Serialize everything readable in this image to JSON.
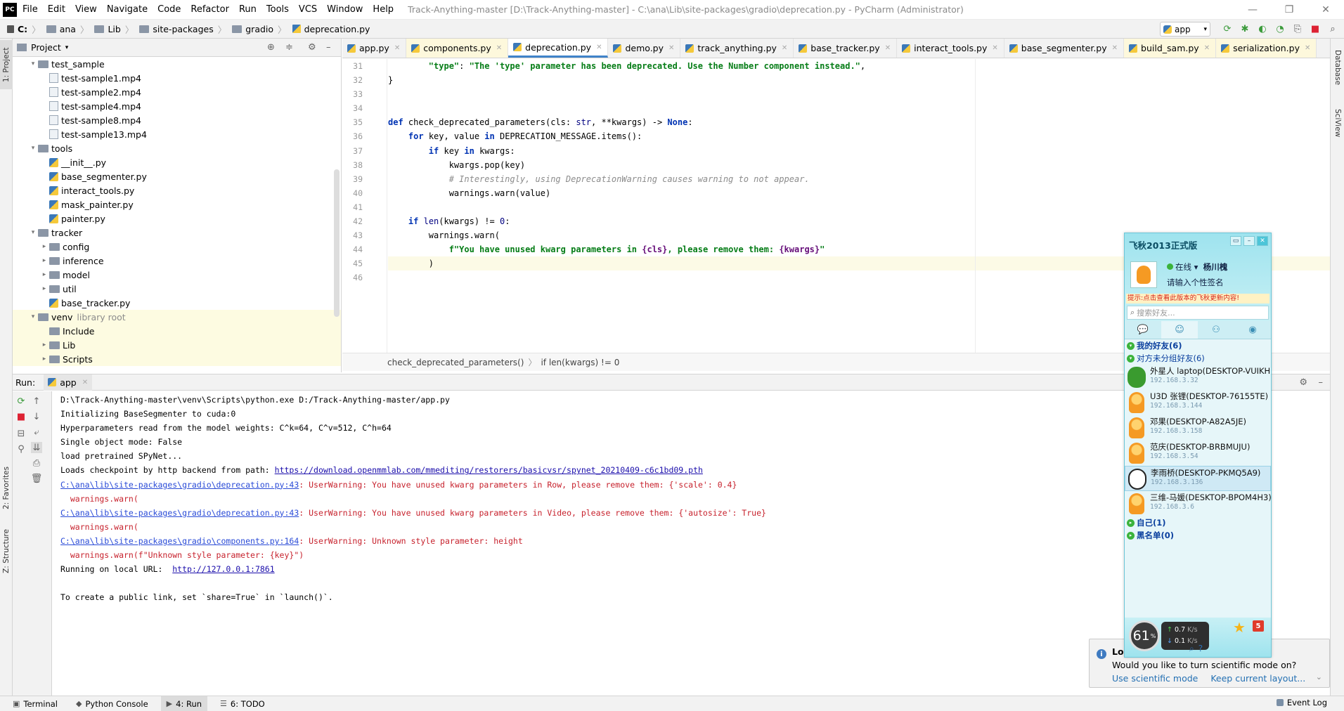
{
  "window": {
    "app_logo": "PC",
    "title": "Track-Anything-master [D:\\Track-Anything-master] - C:\\ana\\Lib\\site-packages\\gradio\\deprecation.py - PyCharm (Administrator)",
    "menu": [
      "File",
      "Edit",
      "View",
      "Navigate",
      "Code",
      "Refactor",
      "Run",
      "Tools",
      "VCS",
      "Window",
      "Help"
    ],
    "controls": [
      "—",
      "❐",
      "✕"
    ]
  },
  "breadcrumb": [
    "C:",
    "ana",
    "Lib",
    "site-packages",
    "gradio",
    "deprecation.py"
  ],
  "run_config": "app",
  "left_strip": {
    "project": "1: Project",
    "favorites": "2: Favorites",
    "structure": "Z: Structure"
  },
  "right_strip": {
    "database": "Database",
    "sciview": "SciView"
  },
  "project": {
    "title": "Project",
    "tree": [
      {
        "depth": 1,
        "arrow": "▾",
        "type": "folder",
        "label": "test_sample"
      },
      {
        "depth": 2,
        "arrow": "",
        "type": "file",
        "label": "test-sample1.mp4"
      },
      {
        "depth": 2,
        "arrow": "",
        "type": "file",
        "label": "test-sample2.mp4"
      },
      {
        "depth": 2,
        "arrow": "",
        "type": "file",
        "label": "test-sample4.mp4"
      },
      {
        "depth": 2,
        "arrow": "",
        "type": "file",
        "label": "test-sample8.mp4"
      },
      {
        "depth": 2,
        "arrow": "",
        "type": "file",
        "label": "test-sample13.mp4"
      },
      {
        "depth": 1,
        "arrow": "▾",
        "type": "folder",
        "label": "tools"
      },
      {
        "depth": 2,
        "arrow": "",
        "type": "py",
        "label": "__init__.py"
      },
      {
        "depth": 2,
        "arrow": "",
        "type": "py",
        "label": "base_segmenter.py"
      },
      {
        "depth": 2,
        "arrow": "",
        "type": "py",
        "label": "interact_tools.py"
      },
      {
        "depth": 2,
        "arrow": "",
        "type": "py",
        "label": "mask_painter.py"
      },
      {
        "depth": 2,
        "arrow": "",
        "type": "py",
        "label": "painter.py"
      },
      {
        "depth": 1,
        "arrow": "▾",
        "type": "folder",
        "label": "tracker"
      },
      {
        "depth": 2,
        "arrow": "▸",
        "type": "folder",
        "label": "config"
      },
      {
        "depth": 2,
        "arrow": "▸",
        "type": "folder",
        "label": "inference"
      },
      {
        "depth": 2,
        "arrow": "▸",
        "type": "folder",
        "label": "model"
      },
      {
        "depth": 2,
        "arrow": "▸",
        "type": "folder",
        "label": "util"
      },
      {
        "depth": 2,
        "arrow": "",
        "type": "py",
        "label": "base_tracker.py"
      },
      {
        "depth": 1,
        "arrow": "▾",
        "type": "folder",
        "label": "venv",
        "note": "library root",
        "highlight": true
      },
      {
        "depth": 2,
        "arrow": "",
        "type": "folder",
        "label": "Include",
        "highlight": true
      },
      {
        "depth": 2,
        "arrow": "▸",
        "type": "folder",
        "label": "Lib",
        "highlight": true
      },
      {
        "depth": 2,
        "arrow": "▸",
        "type": "folder",
        "label": "Scripts",
        "highlight": true
      }
    ]
  },
  "editor": {
    "tabs": [
      {
        "label": "app.py",
        "state": ""
      },
      {
        "label": "components.py",
        "state": "modified"
      },
      {
        "label": "deprecation.py",
        "state": "active"
      },
      {
        "label": "demo.py",
        "state": ""
      },
      {
        "label": "track_anything.py",
        "state": ""
      },
      {
        "label": "base_tracker.py",
        "state": ""
      },
      {
        "label": "interact_tools.py",
        "state": ""
      },
      {
        "label": "base_segmenter.py",
        "state": ""
      },
      {
        "label": "build_sam.py",
        "state": "modified"
      },
      {
        "label": "serialization.py",
        "state": "modified"
      }
    ],
    "line_numbers": [
      "31",
      "32",
      "33",
      "34",
      "35",
      "36",
      "37",
      "38",
      "39",
      "40",
      "41",
      "42",
      "43",
      "44",
      "45",
      "46"
    ],
    "current_line_index": 14,
    "breadcrumb": [
      "check_deprecated_parameters()",
      "if len(kwargs) != 0"
    ],
    "code": [
      [
        {
          "t": "        ",
          "c": ""
        },
        {
          "t": "\"type\"",
          "c": "str"
        },
        {
          "t": ": ",
          "c": ""
        },
        {
          "t": "\"The 'type' parameter has been deprecated. Use the Number component instead.\"",
          "c": "str"
        },
        {
          "t": ",",
          "c": ""
        }
      ],
      [
        {
          "t": "}",
          "c": ""
        }
      ],
      [],
      [],
      [
        {
          "t": "def ",
          "c": "kw"
        },
        {
          "t": "check_deprecated_parameters",
          "c": "fn"
        },
        {
          "t": "(cls: ",
          "c": ""
        },
        {
          "t": "str",
          "c": "bi"
        },
        {
          "t": ", **kwargs) -> ",
          "c": ""
        },
        {
          "t": "None",
          "c": "kw"
        },
        {
          "t": ":",
          "c": ""
        }
      ],
      [
        {
          "t": "    ",
          "c": ""
        },
        {
          "t": "for ",
          "c": "kw"
        },
        {
          "t": "key, value ",
          "c": ""
        },
        {
          "t": "in ",
          "c": "kw"
        },
        {
          "t": "DEPRECATION_MESSAGE.items():",
          "c": ""
        }
      ],
      [
        {
          "t": "        ",
          "c": ""
        },
        {
          "t": "if ",
          "c": "kw"
        },
        {
          "t": "key ",
          "c": ""
        },
        {
          "t": "in ",
          "c": "kw"
        },
        {
          "t": "kwargs:",
          "c": ""
        }
      ],
      [
        {
          "t": "            kwargs.pop(key)",
          "c": ""
        }
      ],
      [
        {
          "t": "            ",
          "c": ""
        },
        {
          "t": "# Interestingly, using DeprecationWarning causes warning to not appear.",
          "c": "cm"
        }
      ],
      [
        {
          "t": "            warnings.warn(value)",
          "c": ""
        }
      ],
      [],
      [
        {
          "t": "    ",
          "c": ""
        },
        {
          "t": "if ",
          "c": "kw"
        },
        {
          "t": "len",
          "c": "bi"
        },
        {
          "t": "(kwargs) != ",
          "c": ""
        },
        {
          "t": "0",
          "c": "bi"
        },
        {
          "t": ":",
          "c": ""
        }
      ],
      [
        {
          "t": "        warnings.warn(",
          "c": ""
        }
      ],
      [
        {
          "t": "            ",
          "c": ""
        },
        {
          "t": "f\"You have unused kwarg parameters in ",
          "c": "str"
        },
        {
          "t": "{cls}",
          "c": "ivar"
        },
        {
          "t": ", please remove them: ",
          "c": "str"
        },
        {
          "t": "{kwargs}",
          "c": "ivar"
        },
        {
          "t": "\"",
          "c": "str"
        }
      ],
      [
        {
          "t": "        )",
          "c": ""
        }
      ],
      []
    ]
  },
  "run": {
    "label": "Run:",
    "tab": "app",
    "output": [
      [
        {
          "t": "D:\\Track-Anything-master\\venv\\Scripts\\python.exe D:/Track-Anything-master/app.py",
          "c": ""
        }
      ],
      [
        {
          "t": "Initializing BaseSegmenter to cuda:0",
          "c": ""
        }
      ],
      [
        {
          "t": "Hyperparameters read from the model weights: C^k=64, C^v=512, C^h=64",
          "c": ""
        }
      ],
      [
        {
          "t": "Single object mode: False",
          "c": ""
        }
      ],
      [
        {
          "t": "load pretrained SPyNet...",
          "c": ""
        }
      ],
      [
        {
          "t": "Loads checkpoint by http backend from path: ",
          "c": ""
        },
        {
          "t": "https://download.openmmlab.com/mmediting/restorers/basicvsr/spynet_20210409-c6c1bd09.pth",
          "c": "lnk"
        }
      ],
      [
        {
          "t": "C:\\ana\\lib\\site-packages\\gradio\\deprecation.py:43",
          "c": "lnk2"
        },
        {
          "t": ": UserWarning: You have unused kwarg parameters in Row, please remove them: {'scale': 0.4}",
          "c": "err"
        }
      ],
      [
        {
          "t": "  warnings.warn(",
          "c": "err"
        }
      ],
      [
        {
          "t": "C:\\ana\\lib\\site-packages\\gradio\\deprecation.py:43",
          "c": "lnk2"
        },
        {
          "t": ": UserWarning: You have unused kwarg parameters in Video, please remove them: {'autosize': True}",
          "c": "err"
        }
      ],
      [
        {
          "t": "  warnings.warn(",
          "c": "err"
        }
      ],
      [
        {
          "t": "C:\\ana\\lib\\site-packages\\gradio\\components.py:164",
          "c": "lnk2"
        },
        {
          "t": ": UserWarning: Unknown style parameter: height",
          "c": "err"
        }
      ],
      [
        {
          "t": "  warnings.warn(f\"Unknown style parameter: {key}\")",
          "c": "err"
        }
      ],
      [
        {
          "t": "Running on local URL:  ",
          "c": ""
        },
        {
          "t": "http://127.0.0.1:7861",
          "c": "lnk"
        }
      ],
      [],
      [
        {
          "t": "To create a public link, set `share=True` in `launch()`.",
          "c": ""
        }
      ]
    ]
  },
  "bottom_tabs": [
    {
      "icon": "▣",
      "label": "Terminal",
      "active": false
    },
    {
      "icon": "◆",
      "label": "Python Console",
      "active": false
    },
    {
      "icon": "▶",
      "label": "4: Run",
      "active": true
    },
    {
      "icon": "☰",
      "label": "6: TODO",
      "active": false
    }
  ],
  "event_log": "Event Log",
  "notification": {
    "title": "Loc",
    "message": "Would you like to turn scientific mode on?",
    "actions": [
      "Use scientific mode",
      "Keep current layout..."
    ]
  },
  "qq": {
    "title": "飞秋2013正式版",
    "status": "在线",
    "username": "杨川槐",
    "signature": "请输入个性签名",
    "tip": "提示:点击查看此版本的飞秋更新内容!",
    "search_placeholder": "搜索好友...",
    "groups": {
      "mine": "我的好友(6)",
      "ungrouped": "对方未分组好友(6)",
      "self": "自己(1)",
      "blacklist": "黑名单(0)"
    },
    "friends": [
      {
        "name": "外星人 laptop(DESKTOP-VUIKH",
        "ip": "192.168.3.32",
        "avatar": "frog",
        "selected": false
      },
      {
        "name": "U3D 张锂(DESKTOP-76155TE)",
        "ip": "192.168.3.144",
        "avatar": "bean",
        "selected": false
      },
      {
        "name": "邓果(DESKTOP-A82A5JE)",
        "ip": "192.168.3.158",
        "avatar": "bean",
        "selected": false
      },
      {
        "name": "范庆(DESKTOP-BRBMUJU)",
        "ip": "192.168.3.54",
        "avatar": "bean",
        "selected": false
      },
      {
        "name": "李雨桥(DESKTOP-PKMQ5A9)",
        "ip": "192.168.3.136",
        "avatar": "face",
        "selected": true
      },
      {
        "name": "三维-马媛(DESKTOP-BPOM4H3)",
        "ip": "192.168.3.6",
        "avatar": "bean",
        "selected": false
      }
    ],
    "gauge_value": "61",
    "gauge_unit": "%",
    "upload": "0.7",
    "download": "0.1",
    "speed_unit": "K/s",
    "badge": "5"
  }
}
